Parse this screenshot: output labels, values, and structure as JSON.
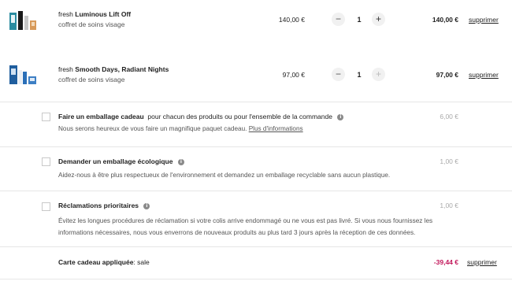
{
  "products": [
    {
      "brand": "fresh",
      "name": "Luminous Lift Off",
      "subtitle": "coffret de soins visage",
      "unit_price": "140,00 €",
      "minus": "−",
      "quantity": "1",
      "plus": "+",
      "total": "140,00 €",
      "remove": "supprimer"
    },
    {
      "brand": "fresh",
      "name": "Smooth Days, Radiant Nights",
      "subtitle": "coffret de soins visage",
      "unit_price": "97,00 €",
      "minus": "−",
      "quantity": "1",
      "plus": "+",
      "total": "97,00 €",
      "remove": "supprimer"
    }
  ],
  "options": [
    {
      "title": "Faire un emballage cadeau",
      "title_suffix": "pour chacun des produits ou pour l'ensemble de la commande",
      "description": "Nous serons heureux de vous faire un magnifique paquet cadeau.",
      "link": "Plus d'informations",
      "price": "6,00 €"
    },
    {
      "title": "Demander un emballage écologique",
      "description": "Aidez-nous à être plus respectueux de l'environnement et demandez un emballage recyclable sans aucun plastique.",
      "price": "1,00 €"
    },
    {
      "title": "Réclamations prioritaires",
      "description": "Évitez les longues procédures de réclamation si votre colis arrive endommagé ou ne vous est pas livré. Si vous nous fournissez les informations nécessaires, nous vous enverrons de nouveaux produits au plus tard 3 jours après la réception de ces données.",
      "price": "1,00 €"
    }
  ],
  "gift_card": {
    "label": "Carte cadeau appliquée",
    "value": ": sale",
    "amount": "-39,44 €",
    "remove": "supprimer"
  },
  "info_symbol": "i",
  "colors": {
    "negative": "#c2185b",
    "separator": "#e6e6e6"
  }
}
